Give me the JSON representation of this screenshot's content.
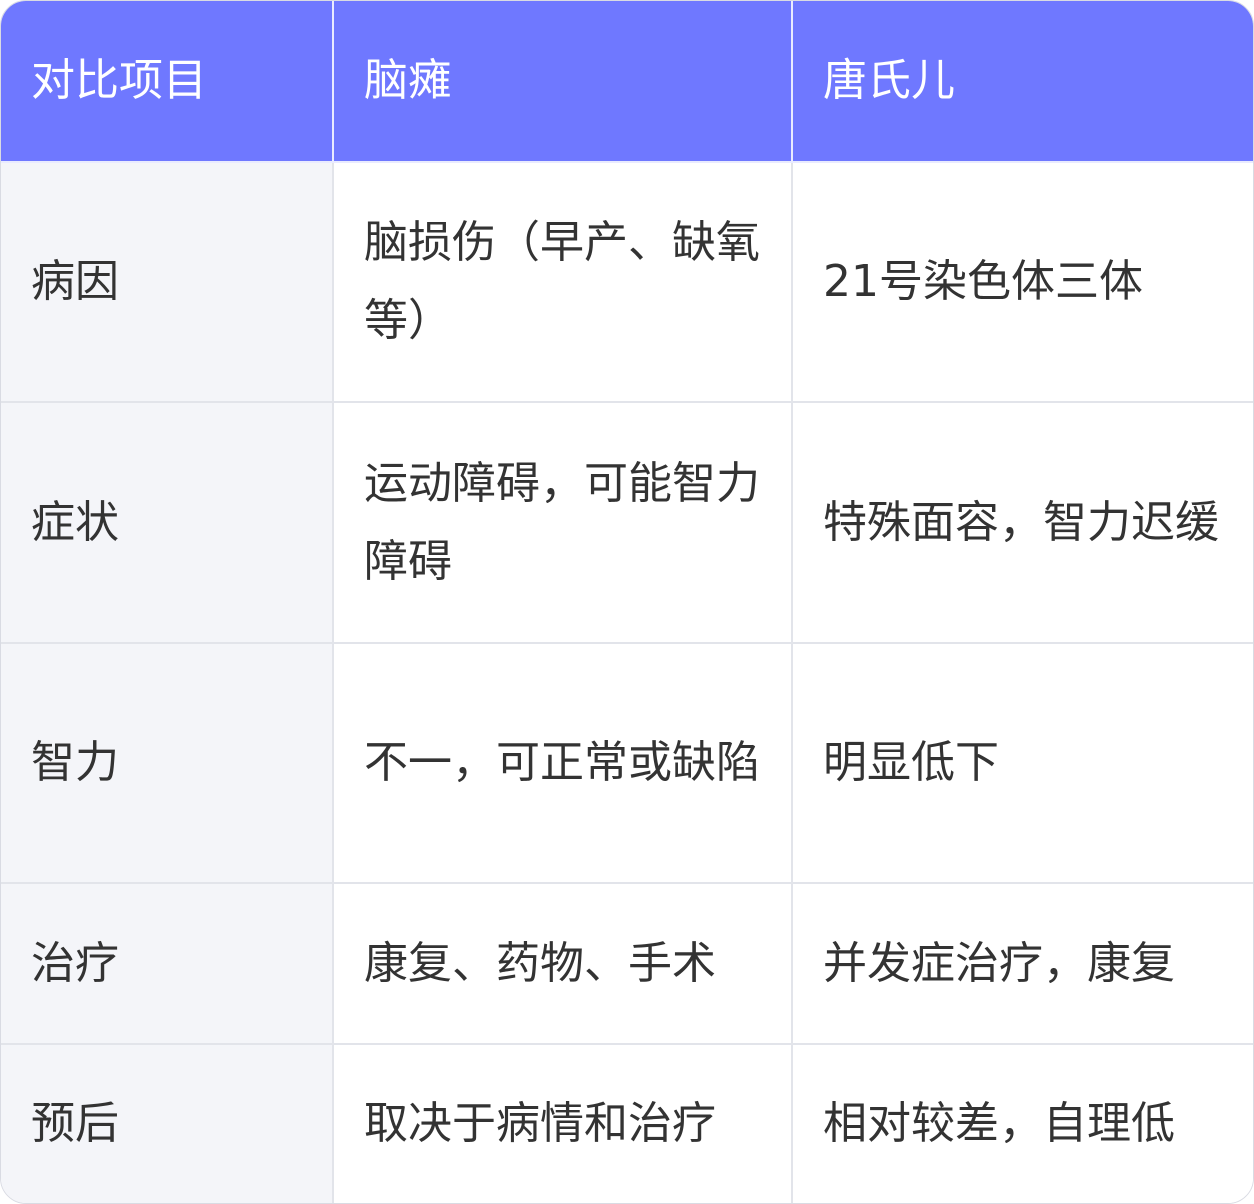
{
  "table": {
    "headers": [
      "对比项目",
      "脑瘫",
      "唐氏儿"
    ],
    "rows": [
      {
        "label": "病因",
        "cerebral_palsy": "脑损伤（早产、缺氧等）",
        "down_syndrome": "21号染色体三体"
      },
      {
        "label": "症状",
        "cerebral_palsy": "运动障碍，可能智力障碍",
        "down_syndrome": "特殊面容，智力迟缓"
      },
      {
        "label": "智力",
        "cerebral_palsy": "不一，可正常或缺陷",
        "down_syndrome": "明显低下"
      },
      {
        "label": "治疗",
        "cerebral_palsy": "康复、药物、手术",
        "down_syndrome": "并发症治疗，康复"
      },
      {
        "label": "预后",
        "cerebral_palsy": "取决于病情和治疗",
        "down_syndrome": "相对较差，自理低"
      }
    ]
  },
  "colors": {
    "header_bg": "#6f78ff",
    "header_text": "#ffffff",
    "label_bg": "#f4f5f9",
    "cell_text": "#333333",
    "border": "#e2e4ea"
  }
}
